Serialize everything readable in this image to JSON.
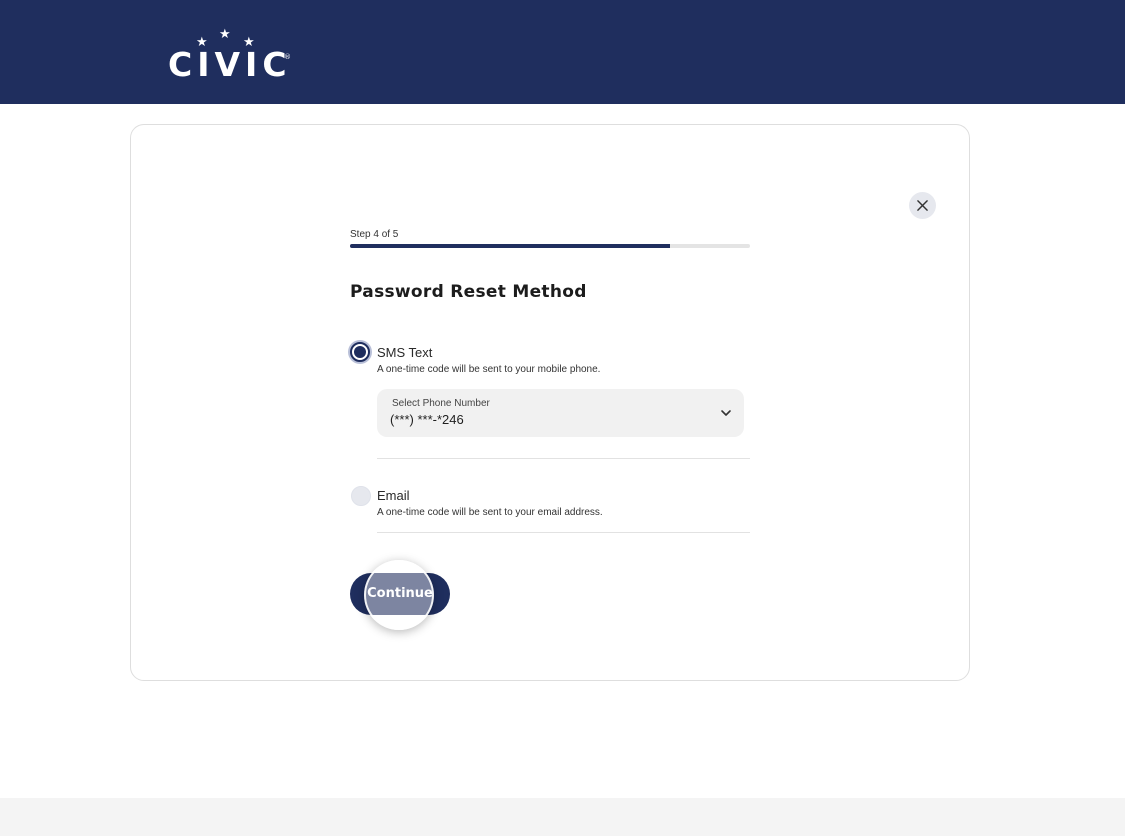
{
  "header": {
    "logo_text": "CIVIC",
    "logo_reg": "®",
    "background": "#1f2e5e"
  },
  "form": {
    "step_label": "Step 4 of 5",
    "progress": 0.8,
    "title": "Password Reset Method",
    "close_icon": "close-icon",
    "options": [
      {
        "label": "SMS Text",
        "description": "A one-time code will be sent to your mobile phone.",
        "selected": true
      },
      {
        "label": "Email",
        "description": "A one-time code will be sent to your email address.",
        "selected": false
      }
    ],
    "phone_select": {
      "label": "Select Phone Number",
      "value": "(***) ***-*246"
    },
    "continue_label": "Continue"
  },
  "colors": {
    "accent": "#1f2e5e",
    "progress_track": "#e4e4e4",
    "select_bg": "#f1f1f1"
  }
}
